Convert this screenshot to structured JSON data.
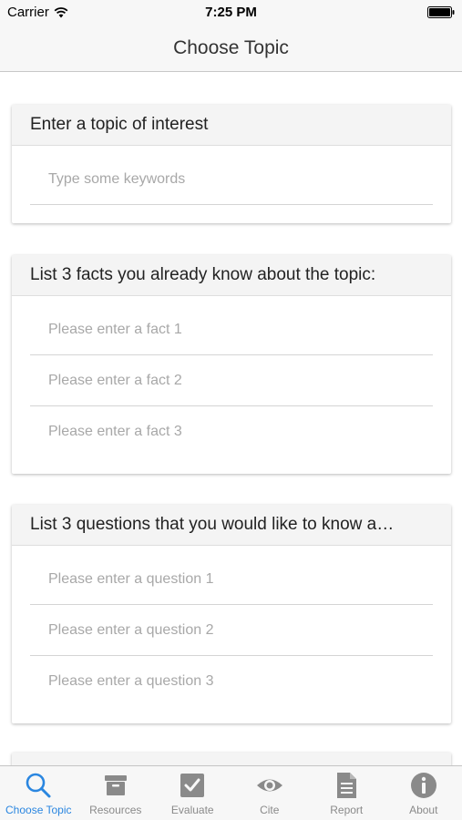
{
  "status_bar": {
    "carrier": "Carrier",
    "time": "7:25 PM"
  },
  "nav": {
    "title": "Choose Topic"
  },
  "topic_card": {
    "header": "Enter a topic of interest",
    "fields": [
      {
        "placeholder": "Type some keywords",
        "value": ""
      }
    ]
  },
  "facts_card": {
    "header": "List 3 facts you already know about the topic:",
    "fields": [
      {
        "placeholder": "Please enter a fact 1",
        "value": ""
      },
      {
        "placeholder": "Please enter a fact 2",
        "value": ""
      },
      {
        "placeholder": "Please enter a fact 3",
        "value": ""
      }
    ]
  },
  "questions_card": {
    "header": "List 3 questions that you would like to know a…",
    "fields": [
      {
        "placeholder": "Please enter a question 1",
        "value": ""
      },
      {
        "placeholder": "Please enter a question 2",
        "value": ""
      },
      {
        "placeholder": "Please enter a question 3",
        "value": ""
      }
    ]
  },
  "tabs": [
    {
      "label": "Choose Topic",
      "icon": "search-icon",
      "active": true
    },
    {
      "label": "Resources",
      "icon": "archive-box-icon",
      "active": false
    },
    {
      "label": "Evaluate",
      "icon": "checkbox-icon",
      "active": false
    },
    {
      "label": "Cite",
      "icon": "eye-icon",
      "active": false
    },
    {
      "label": "Report",
      "icon": "document-icon",
      "active": false
    },
    {
      "label": "About",
      "icon": "info-icon",
      "active": false
    }
  ],
  "colors": {
    "accent": "#2a86e0",
    "inactive": "#8a8a8a",
    "header_bg": "#f4f4f4",
    "bar_bg": "#f7f7f7"
  }
}
